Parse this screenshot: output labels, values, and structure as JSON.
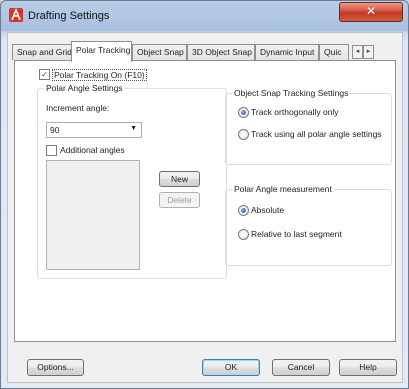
{
  "window": {
    "title": "Drafting Settings",
    "close_glyph": "✕"
  },
  "tabs": [
    {
      "label": "Snap and Grid"
    },
    {
      "label": "Polar Tracking"
    },
    {
      "label": "Object Snap"
    },
    {
      "label": "3D Object Snap"
    },
    {
      "label": "Dynamic Input"
    },
    {
      "label": "Quic"
    }
  ],
  "tab_scroll": {
    "left": "◂",
    "right": "▸"
  },
  "polar_tracking_on": {
    "label": "Polar Tracking On (F10)",
    "checked": true
  },
  "polar_angle_settings": {
    "title": "Polar Angle Settings",
    "increment_label": "Increment angle:",
    "increment_value": "90",
    "additional_angles_label": "Additional angles",
    "additional_angles_checked": false,
    "new_button": "New",
    "delete_button": "Delete"
  },
  "object_snap_tracking": {
    "title": "Object Snap Tracking Settings",
    "options": [
      "Track orthogonally only",
      "Track using all polar angle settings"
    ],
    "selected": 0
  },
  "polar_angle_measurement": {
    "title": "Polar Angle measurement",
    "options": [
      "Absolute",
      "Relative to last segment"
    ],
    "selected": 0
  },
  "footer": {
    "options": "Options...",
    "ok": "OK",
    "cancel": "Cancel",
    "help": "Help"
  },
  "colors": {
    "accent": "#1f4f9a",
    "close": "#c03a22",
    "titlebar": "#a8c0df"
  }
}
